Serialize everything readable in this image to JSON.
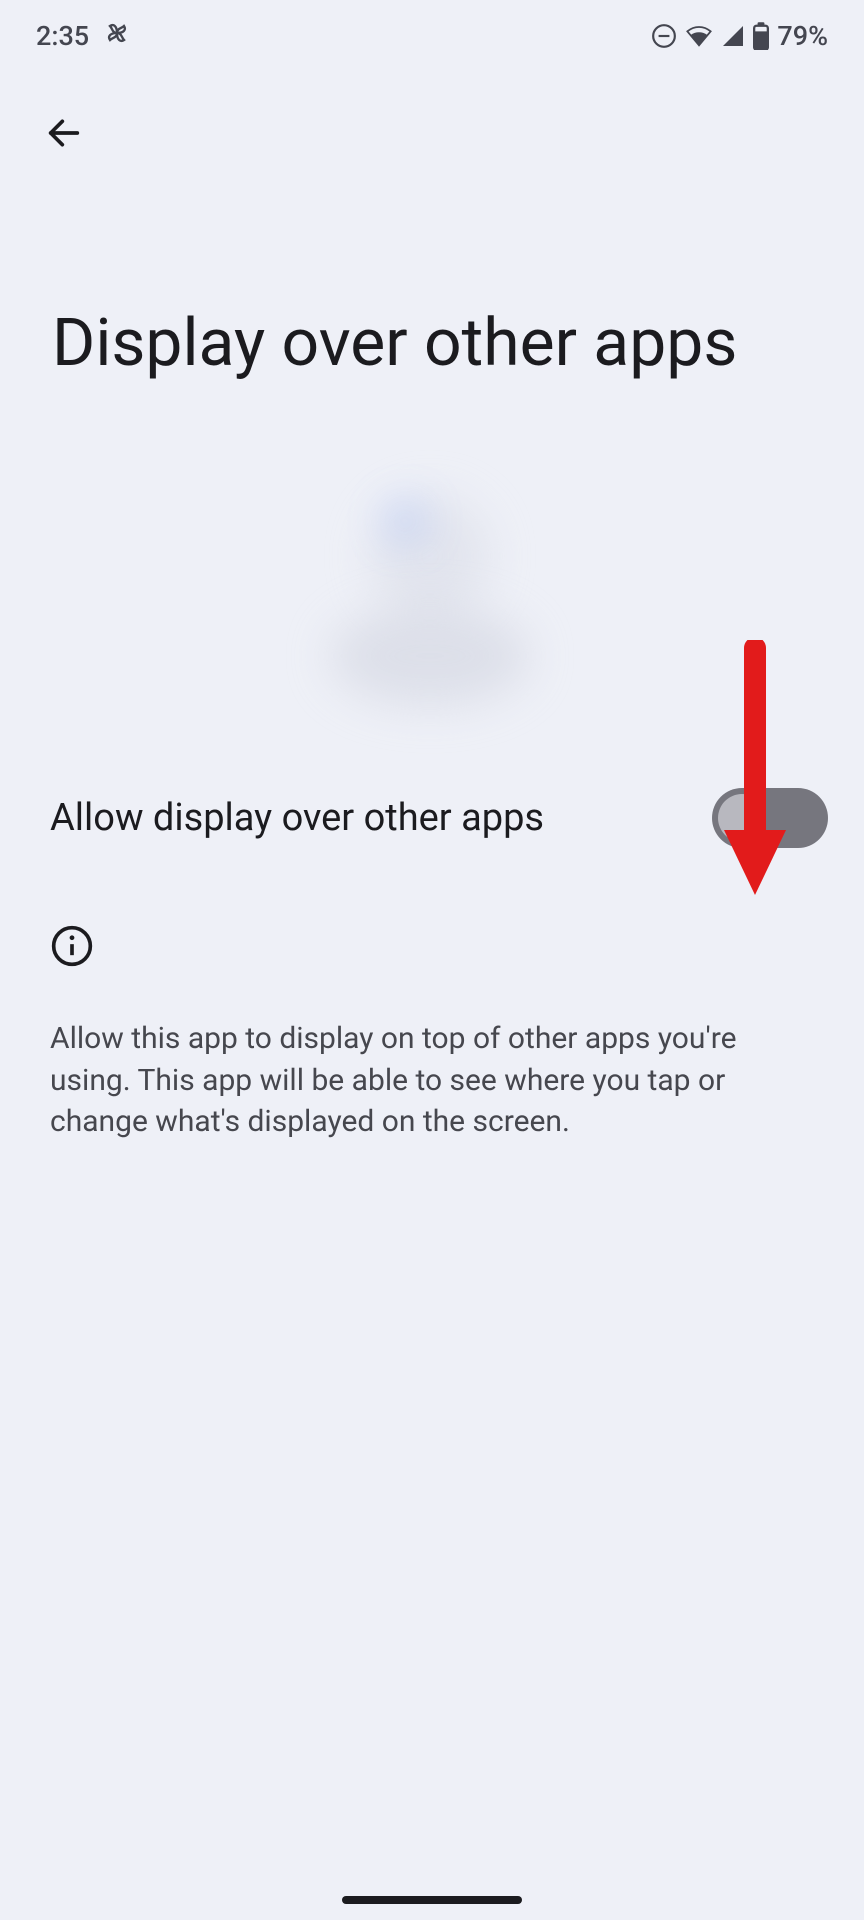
{
  "status_bar": {
    "time": "2:35",
    "battery_percent": "79%"
  },
  "page": {
    "title": "Display over other apps"
  },
  "setting": {
    "label": "Allow display over other apps",
    "enabled": false
  },
  "info": {
    "description": "Allow this app to display on top of other apps you're using. This app will be able to see where you tap or change what's displayed on the screen."
  }
}
